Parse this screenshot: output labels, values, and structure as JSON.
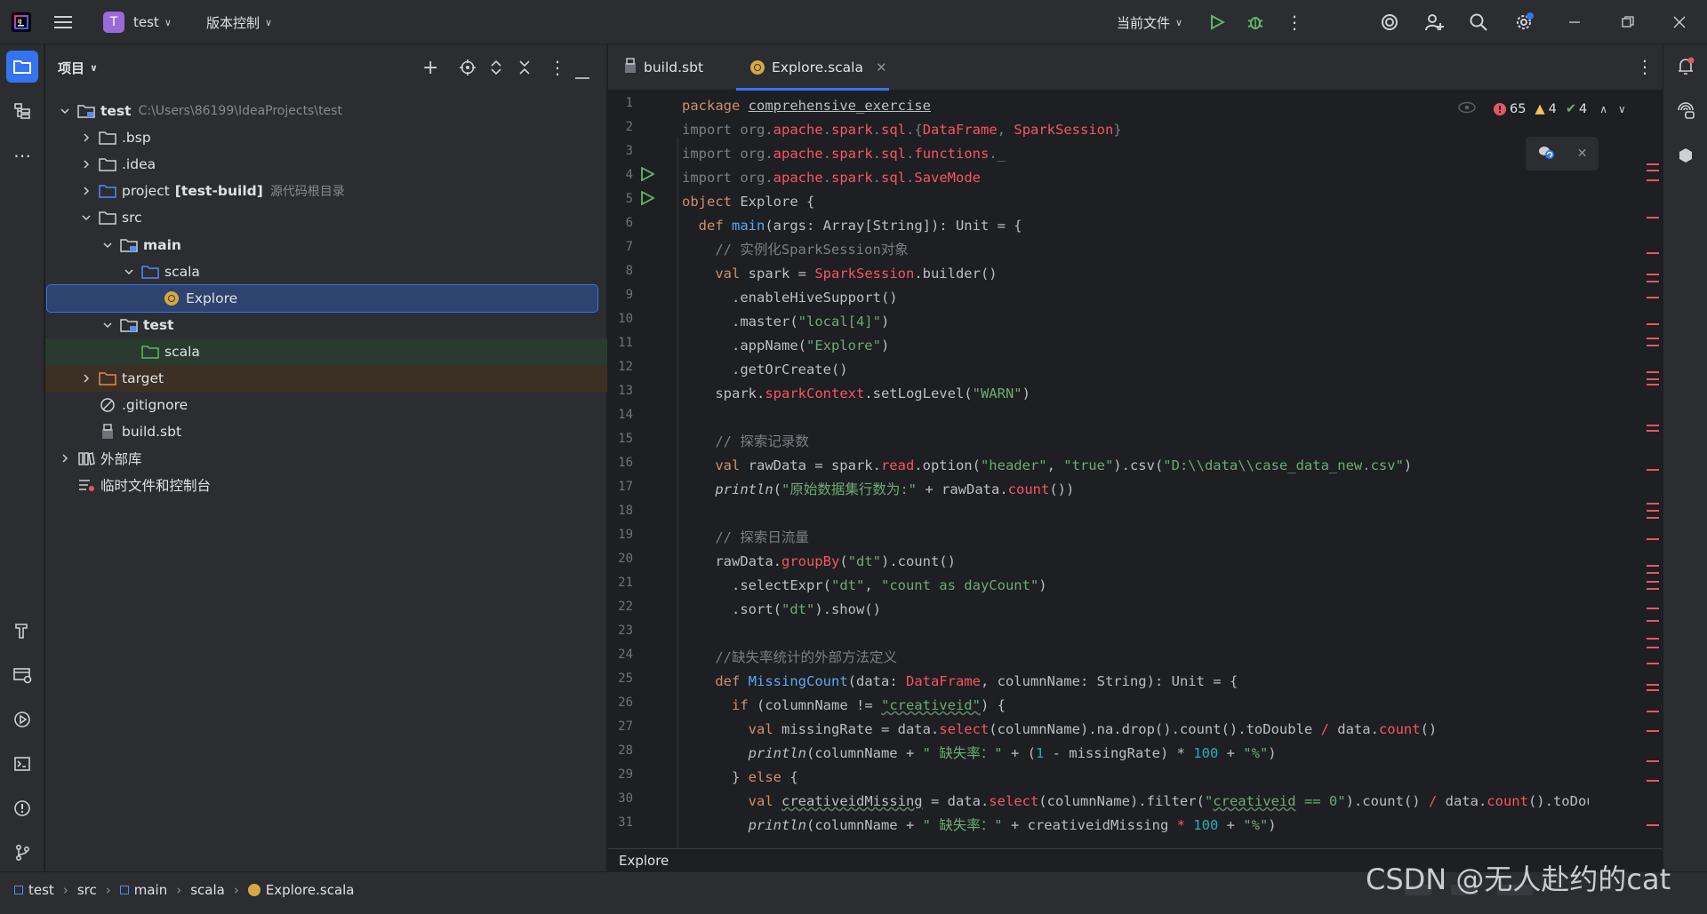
{
  "titlebar": {
    "project_badge": "T",
    "project_name": "test",
    "vcs_label": "版本控制",
    "run_config": "当前文件"
  },
  "project_panel": {
    "title": "项目",
    "tree": [
      {
        "label": "test",
        "hint": "C:\\Users\\86199\\IdeaProjects\\test",
        "depth": 0,
        "expanded": true,
        "icon": "module-folder",
        "bold": true
      },
      {
        "label": ".bsp",
        "depth": 1,
        "expanded": false,
        "icon": "folder"
      },
      {
        "label": ".idea",
        "depth": 1,
        "expanded": false,
        "icon": "folder"
      },
      {
        "label": "project",
        "label2": "[test-build]",
        "hint": "源代码根目录",
        "depth": 1,
        "expanded": false,
        "icon": "source-folder"
      },
      {
        "label": "src",
        "depth": 1,
        "expanded": true,
        "icon": "folder"
      },
      {
        "label": "main",
        "depth": 2,
        "expanded": true,
        "icon": "module-folder",
        "bold": true
      },
      {
        "label": "scala",
        "depth": 3,
        "expanded": true,
        "icon": "source-folder"
      },
      {
        "label": "Explore",
        "depth": 4,
        "icon": "scala-object",
        "selected": true
      },
      {
        "label": "test",
        "depth": 2,
        "expanded": true,
        "icon": "module-folder",
        "bold": true
      },
      {
        "label": "scala",
        "depth": 3,
        "icon": "test-folder",
        "row_style": "test"
      },
      {
        "label": "target",
        "depth": 1,
        "expanded": false,
        "icon": "excluded-folder",
        "row_style": "excluded"
      },
      {
        "label": ".gitignore",
        "depth": 1,
        "icon": "ignore-file"
      },
      {
        "label": "build.sbt",
        "depth": 1,
        "icon": "sbt-file"
      },
      {
        "label": "外部库",
        "depth": 0,
        "expanded": false,
        "icon": "library"
      },
      {
        "label": "临时文件和控制台",
        "depth": 0,
        "icon": "scratch"
      }
    ]
  },
  "editor": {
    "tabs": [
      {
        "label": "build.sbt",
        "icon": "sbt-file",
        "active": false
      },
      {
        "label": "Explore.scala",
        "icon": "scala-object",
        "active": true
      }
    ],
    "inspections": {
      "errors": "65",
      "warnings": "4",
      "ok": "4"
    },
    "breadcrumb": "Explore",
    "run_gutter_lines": [
      5,
      6
    ],
    "line_numbers": [
      "1",
      "2",
      "3",
      "4",
      "5",
      "6",
      "7",
      "8",
      "9",
      "10",
      "11",
      "12",
      "13",
      "14",
      "15",
      "16",
      "17",
      "18",
      "19",
      "20",
      "21",
      "22",
      "23",
      "24",
      "25",
      "26",
      "27",
      "28",
      "29",
      "30",
      "31"
    ]
  },
  "statusbar": {
    "crumbs": [
      "test",
      "src",
      "main",
      "scala",
      "Explore.scala"
    ],
    "watermark": "CSDN @无人赴约的cat"
  },
  "colors": {
    "accent": "#3574f0",
    "selection": "#2e436e",
    "error": "#e55764",
    "warning": "#f2c55c",
    "ok": "#5fb865"
  }
}
